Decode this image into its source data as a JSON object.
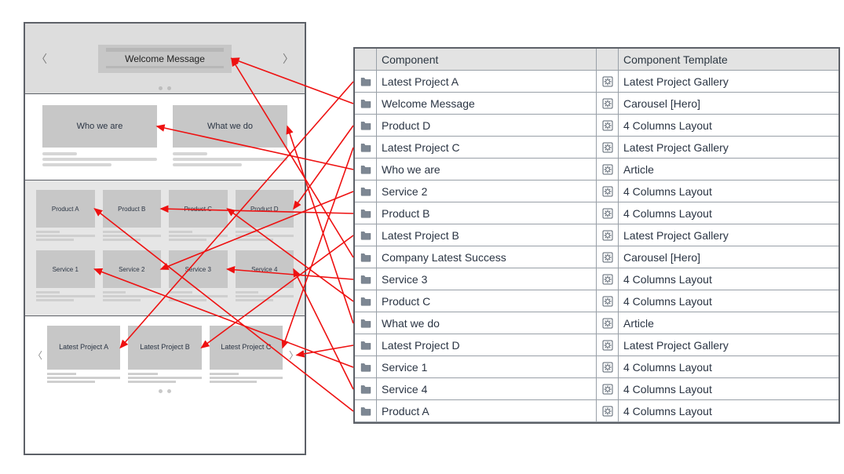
{
  "wireframe": {
    "hero_label": "Welcome Message",
    "articles": [
      "Who we are",
      "What we do"
    ],
    "products": [
      "Product A",
      "Product B",
      "Product C",
      "Product D"
    ],
    "services": [
      "Service 1",
      "Service 2",
      "Service 3",
      "Service 4"
    ],
    "gallery": [
      "Latest Project A",
      "Latest Project B",
      "Latest Project C"
    ]
  },
  "table": {
    "headers": {
      "component": "Component",
      "template": "Component Template"
    },
    "rows": [
      {
        "component": "Latest Project A",
        "template": "Latest Project Gallery"
      },
      {
        "component": "Welcome Message",
        "template": "Carousel [Hero]"
      },
      {
        "component": "Product D",
        "template": "4 Columns Layout"
      },
      {
        "component": "Latest Project C",
        "template": "Latest Project Gallery"
      },
      {
        "component": "Who we are",
        "template": "Article"
      },
      {
        "component": "Service 2",
        "template": "4 Columns Layout"
      },
      {
        "component": "Product B",
        "template": "4 Columns Layout"
      },
      {
        "component": "Latest Project B",
        "template": "Latest Project Gallery"
      },
      {
        "component": "Company Latest Success",
        "template": "Carousel [Hero]"
      },
      {
        "component": "Service 3",
        "template": "4 Columns Layout"
      },
      {
        "component": "Product C",
        "template": "4 Columns Layout"
      },
      {
        "component": "What we do",
        "template": "Article"
      },
      {
        "component": "Latest Project D",
        "template": "Latest Project Gallery"
      },
      {
        "component": "Service 1",
        "template": "4 Columns Layout"
      },
      {
        "component": "Service 4",
        "template": "4 Columns Layout"
      },
      {
        "component": "Product A",
        "template": "4 Columns Layout"
      }
    ]
  },
  "arrows": [
    {
      "from": "row-latest-project-a",
      "to": "wf-gallery-0"
    },
    {
      "from": "row-welcome-message",
      "to": "wf-hero"
    },
    {
      "from": "row-product-d",
      "to": "wf-prod-3"
    },
    {
      "from": "row-latest-project-c",
      "to": "wf-gallery-2"
    },
    {
      "from": "row-who-we-are",
      "to": "wf-art-0"
    },
    {
      "from": "row-service-2",
      "to": "wf-svc-1"
    },
    {
      "from": "row-product-b",
      "to": "wf-prod-1"
    },
    {
      "from": "row-latest-project-b",
      "to": "wf-gallery-1"
    },
    {
      "from": "row-company-latest-success",
      "to": "wf-hero"
    },
    {
      "from": "row-service-3",
      "to": "wf-svc-2"
    },
    {
      "from": "row-product-c",
      "to": "wf-prod-2"
    },
    {
      "from": "row-what-we-do",
      "to": "wf-art-1"
    },
    {
      "from": "row-latest-project-d",
      "to": "wf-gallery-edge"
    },
    {
      "from": "row-service-1",
      "to": "wf-svc-0"
    },
    {
      "from": "row-service-4",
      "to": "wf-svc-3"
    },
    {
      "from": "row-product-a",
      "to": "wf-prod-0"
    }
  ]
}
